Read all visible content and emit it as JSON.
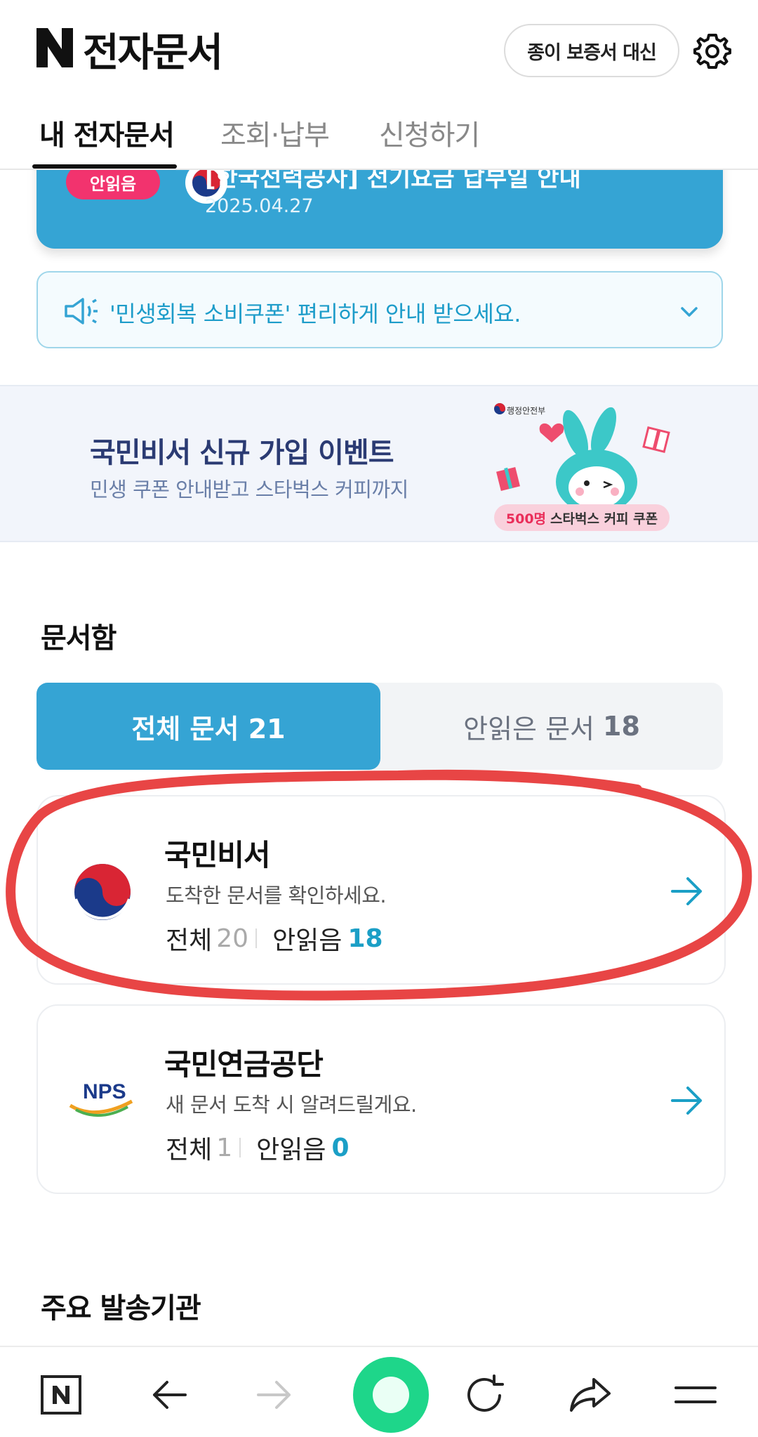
{
  "header": {
    "app_title": "전자문서",
    "paper_button": "종이 보증서 대신"
  },
  "tabs": [
    "내 전자문서",
    "조회·납부",
    "신청하기"
  ],
  "notice_card": {
    "badge": "안읽음",
    "title": "[한국전력공사] 전기요금 납부일 안내",
    "date": "2025.04.27"
  },
  "coupon_notice": {
    "text": "'민생회복 소비쿠폰' 편리하게 안내 받으세요."
  },
  "event_banner": {
    "title": "국민비서 신규 가입 이벤트",
    "subtitle": "민생 쿠폰 안내받고 스타벅스 커피까지",
    "ministry": "행정안전부",
    "coupon_count": "500명",
    "coupon_text": "스타벅스 커피 쿠폰"
  },
  "docbox": {
    "section_title": "문서함",
    "all_tab": "전체 문서 21",
    "unread_label": "안읽은 문서",
    "unread_count": "18"
  },
  "senders": [
    {
      "name": "국민비서",
      "desc": "도착한 문서를 확인하세요.",
      "total_label": "전체",
      "total": "20",
      "unread_label": "안읽음",
      "unread": "18"
    },
    {
      "name": "국민연금공단",
      "logo_text": "NPS",
      "desc": "새 문서 도착 시 알려드릴게요.",
      "total_label": "전체",
      "total": "1",
      "unread_label": "안읽음",
      "unread": "0"
    }
  ],
  "major_senders_title": "주요 발송기관",
  "colors": {
    "accent": "#35a4d4",
    "unread_badge": "#f2336e",
    "highlight": "#e84545"
  },
  "icons": {
    "settings": "gear-icon",
    "speaker": "speaker-icon",
    "nav": [
      "naver-home-icon",
      "back-icon",
      "forward-icon",
      "green-dot-icon",
      "refresh-icon",
      "share-icon",
      "menu-icon"
    ]
  }
}
